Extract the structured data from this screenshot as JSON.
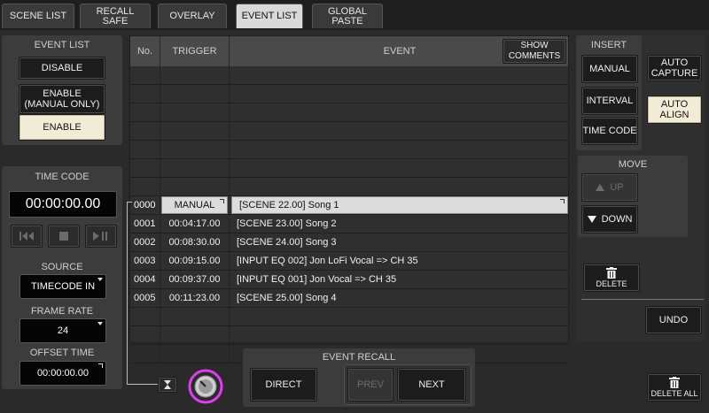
{
  "tabs": [
    {
      "label": "SCENE LIST",
      "active": false
    },
    {
      "label": "RECALL\nSAFE",
      "active": false
    },
    {
      "label": "OVERLAY",
      "active": false
    },
    {
      "label": "EVENT LIST",
      "active": true
    },
    {
      "label": "GLOBAL\nPASTE",
      "active": false
    }
  ],
  "event_list_panel": {
    "title": "EVENT LIST",
    "disable": "DISABLE",
    "enable_manual": "ENABLE\n(MANUAL ONLY)",
    "enable": "ENABLE"
  },
  "timecode": {
    "title": "TIME CODE",
    "value": "00:00:00.00",
    "source_label": "SOURCE",
    "source_value": "TIMECODE IN",
    "frame_rate_label": "FRAME RATE",
    "frame_rate_value": "24",
    "offset_label": "OFFSET TIME",
    "offset_value": "00:00:00.00"
  },
  "table": {
    "headers": {
      "no": "No.",
      "trigger": "TRIGGER",
      "event": "EVENT"
    },
    "show_comments": "SHOW\nCOMMENTS",
    "rows": [
      {
        "no": "0000",
        "trigger": "MANUAL",
        "event": "[SCENE 22.00] Song 1",
        "selected": true
      },
      {
        "no": "0001",
        "trigger": "00:04:17.00",
        "event": "[SCENE 23.00] Song 2"
      },
      {
        "no": "0002",
        "trigger": "00:08:30.00",
        "event": "[SCENE 24.00] Song 3"
      },
      {
        "no": "0003",
        "trigger": "00:09:15.00",
        "event": "[INPUT EQ 002] Jon LoFi Vocal => CH 35"
      },
      {
        "no": "0004",
        "trigger": "00:09:37.00",
        "event": "[INPUT EQ 001] Jon Vocal => CH 35"
      },
      {
        "no": "0005",
        "trigger": "00:11:23.00",
        "event": "[SCENE 25.00] Song 4"
      }
    ]
  },
  "insert": {
    "title": "INSERT",
    "manual": "MANUAL",
    "interval": "INTERVAL",
    "time_code": "TIME CODE",
    "auto_capture": "AUTO\nCAPTURE",
    "auto_align": "AUTO\nALIGN"
  },
  "move": {
    "title": "MOVE",
    "up": "UP",
    "down": "DOWN"
  },
  "actions": {
    "delete": "DELETE",
    "undo": "UNDO",
    "delete_all": "DELETE ALL"
  },
  "event_recall": {
    "title": "EVENT RECALL",
    "direct": "DIRECT",
    "prev": "PREV",
    "next": "NEXT"
  },
  "colors": {
    "knob_ring": "#e23cf2",
    "lit_button": "#f2ecd6"
  }
}
